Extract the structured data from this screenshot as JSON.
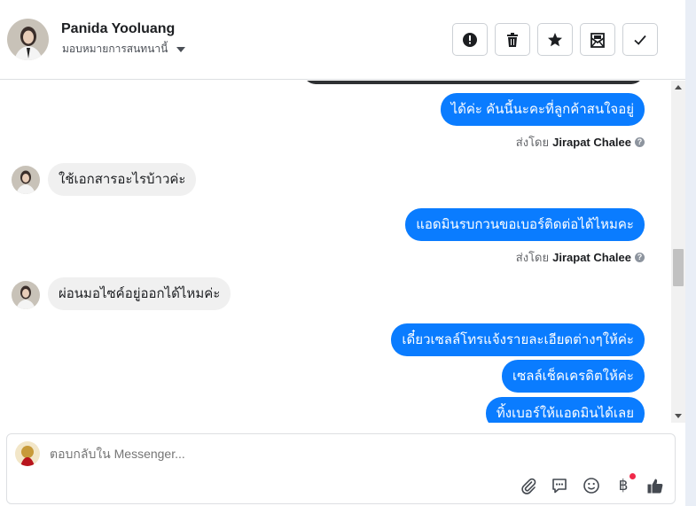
{
  "header": {
    "contact_name": "Panida Yooluang",
    "assign_label": "มอบหมายการสนทนานี้",
    "buttons": [
      {
        "name": "spam-button",
        "icon": "alert-icon"
      },
      {
        "name": "delete-button",
        "icon": "trash-icon"
      },
      {
        "name": "star-button",
        "icon": "star-icon"
      },
      {
        "name": "mark-unread-button",
        "icon": "mail-icon"
      },
      {
        "name": "done-button",
        "icon": "check-icon"
      }
    ]
  },
  "messages": [
    {
      "dir": "out",
      "text": "ได้ค่ะ คันนี้นะคะที่ลูกค้าสนใจอยู่",
      "sent_prefix": "ส่งโดย",
      "sent_by": "Jirapat Chalee"
    },
    {
      "dir": "in",
      "text": "ใช้เอกสารอะไรบ้าวค่ะ"
    },
    {
      "dir": "out",
      "text": "แอดมินรบกวนขอเบอร์ติดต่อได้ไหมคะ",
      "sent_prefix": "ส่งโดย",
      "sent_by": "Jirapat Chalee"
    },
    {
      "dir": "in",
      "text": "ผ่อนมอไซค์อยู่ออกได้ไหมค่ะ"
    },
    {
      "dir": "out",
      "text": "เดี๋ยวเซลล์โทรแจ้งรายละเอียดต่างๆให้ค่ะ"
    },
    {
      "dir": "out",
      "text": "เซลล์เช็คเครดิตให้ค่ะ"
    },
    {
      "dir": "out",
      "text": "ทิ้งเบอร์ให้แอดมินได้เลย"
    }
  ],
  "composer": {
    "placeholder": "ตอบกลับใน Messenger...",
    "icons": [
      "attachment-icon",
      "saved-replies-icon",
      "emoji-icon",
      "baht-payment-icon",
      "like-icon"
    ]
  },
  "colors": {
    "outgoing_bubble": "#0a7cff",
    "incoming_bubble": "#f0f0f0",
    "notification_dot": "#f02849"
  }
}
